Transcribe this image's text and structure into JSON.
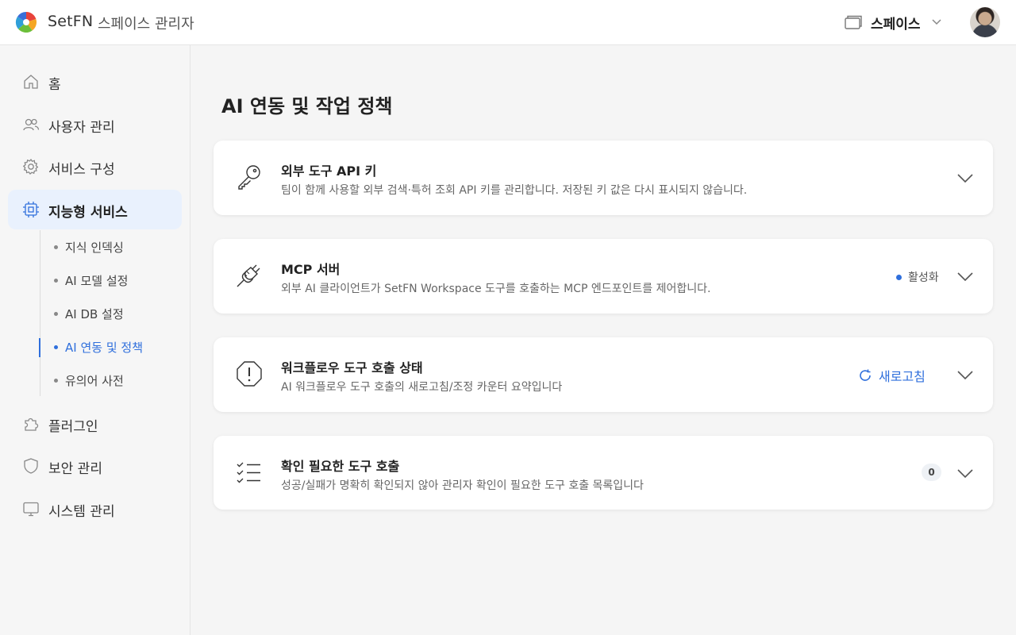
{
  "header": {
    "brand": "SetFN",
    "subtitle": "스페이스 관리자",
    "space_label": "스페이스"
  },
  "sidebar": {
    "items": [
      {
        "label": "홈",
        "icon": "home-icon"
      },
      {
        "label": "사용자 관리",
        "icon": "users-icon"
      },
      {
        "label": "서비스 구성",
        "icon": "gear-icon"
      },
      {
        "label": "지능형 서비스",
        "icon": "chip-icon",
        "active": true
      },
      {
        "label": "플러그인",
        "icon": "puzzle-icon"
      },
      {
        "label": "보안 관리",
        "icon": "shield-icon"
      },
      {
        "label": "시스템 관리",
        "icon": "monitor-icon"
      }
    ],
    "subitems": [
      {
        "label": "지식 인덱싱"
      },
      {
        "label": "AI 모델 설정"
      },
      {
        "label": "AI DB 설정"
      },
      {
        "label": "AI 연동 및 정책",
        "active": true
      },
      {
        "label": "유의어 사전"
      }
    ]
  },
  "main": {
    "title": "AI 연동 및 작업 정책",
    "cards": [
      {
        "title": "외부 도구 API 키",
        "desc": "팀이 함께 사용할 외부 검색·특허 조회 API 키를 관리합니다. 저장된 키 값은 다시 표시되지 않습니다.",
        "icon": "key-icon"
      },
      {
        "title": "MCP 서버",
        "desc": "외부 AI 클라이언트가 SetFN Workspace 도구를 호출하는 MCP 엔드포인트를 제어합니다.",
        "icon": "plug-icon",
        "status": "활성화"
      },
      {
        "title": "워크플로우 도구 호출 상태",
        "desc": "AI 워크플로우 도구 호출의 새로고침/조정 카운터 요약입니다",
        "icon": "alert-octagon-icon",
        "action": "새로고침"
      },
      {
        "title": "확인 필요한 도구 호출",
        "desc": "성공/실패가 명확히 확인되지 않아 관리자 확인이 필요한 도구 호출 목록입니다",
        "icon": "checklist-icon",
        "count": "0"
      }
    ]
  },
  "colors": {
    "accent": "#2f6fdc",
    "active_bg": "#e9f1fd"
  }
}
